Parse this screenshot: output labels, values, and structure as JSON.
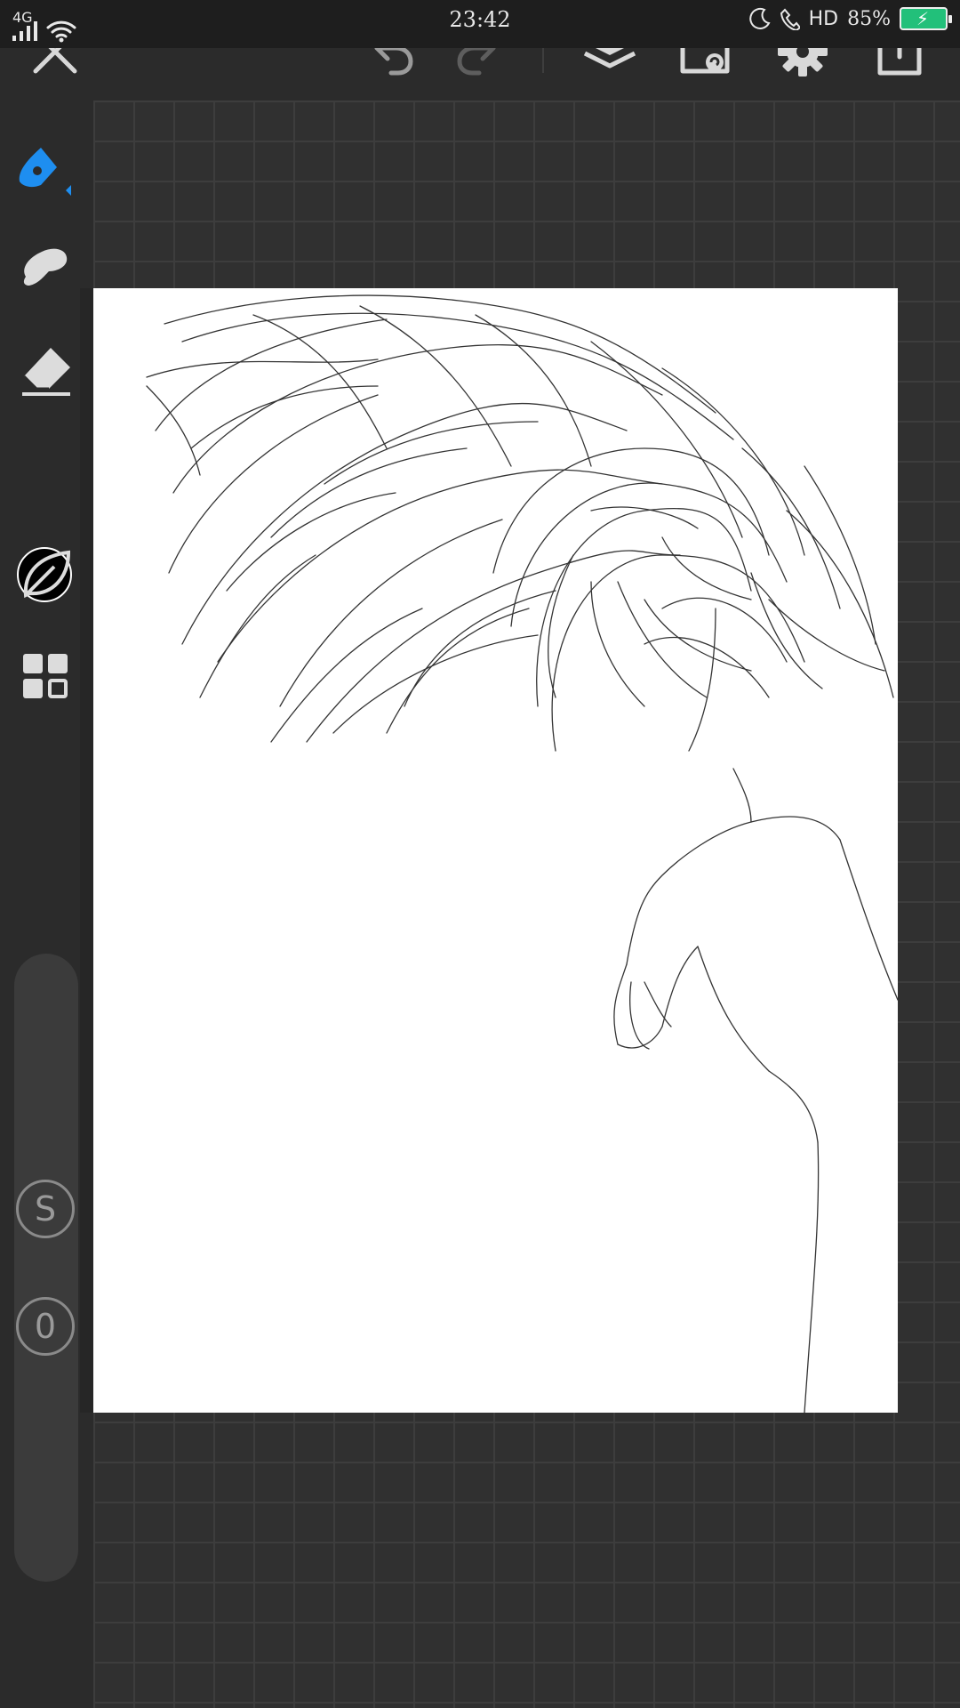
{
  "status_bar": {
    "network": "4G",
    "time": "23:42",
    "hd": "HD",
    "battery": "85%"
  },
  "toolbar": {
    "buttons": [
      "close-icon",
      "undo-icon",
      "redo-icon",
      "layers-icon",
      "folder-icon",
      "gear-icon",
      "export-icon"
    ]
  },
  "tools": {
    "pen": "pen-icon",
    "smudge": "smudge-icon",
    "eraser": "eraser-icon",
    "color": "#000000",
    "leaf": "leaf-icon",
    "grid": "grid-icon",
    "accent": "#1e8ef0"
  },
  "sliders": {
    "size_label": "S",
    "opacity_label": "0"
  }
}
